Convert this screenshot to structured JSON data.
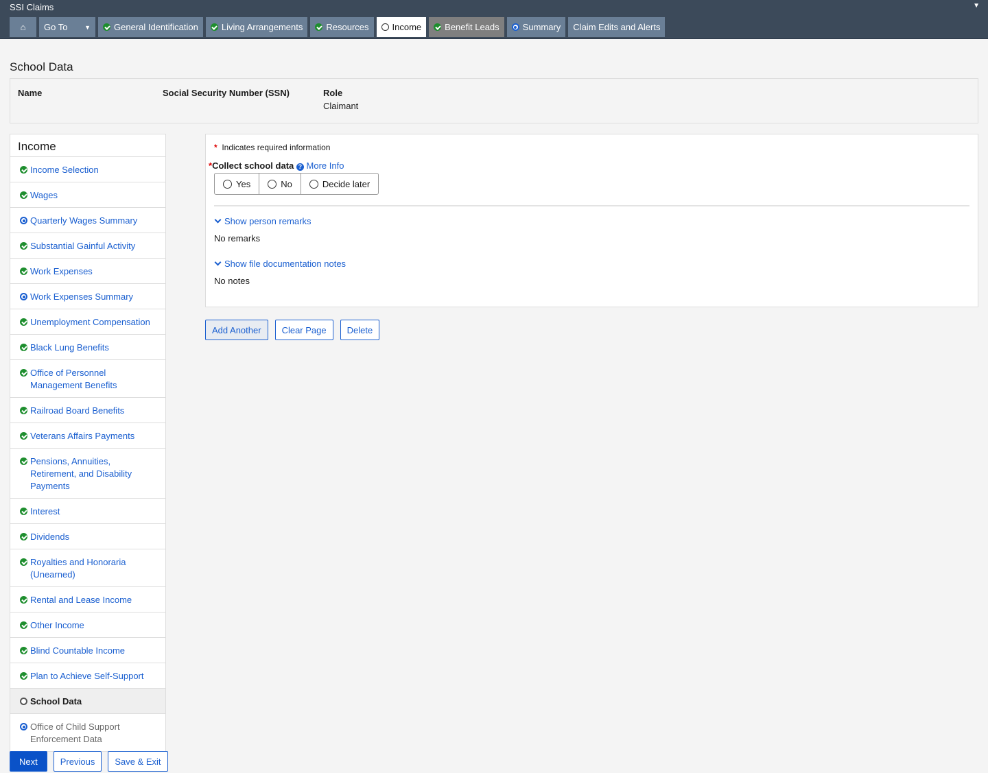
{
  "app": {
    "title": "SSI Claims"
  },
  "nav": {
    "goto": "Go To",
    "tabs": [
      {
        "label": "General Identification",
        "status": "check"
      },
      {
        "label": "Living Arrangements",
        "status": "check"
      },
      {
        "label": "Resources",
        "status": "check"
      },
      {
        "label": "Income",
        "status": "empty"
      },
      {
        "label": "Benefit Leads",
        "status": "check"
      },
      {
        "label": "Summary",
        "status": "target"
      },
      {
        "label": "Claim Edits and Alerts",
        "status": "none"
      }
    ]
  },
  "page": {
    "title": "School Data"
  },
  "person": {
    "name_label": "Name",
    "ssn_label": "Social Security Number (SSN)",
    "role_label": "Role",
    "role_value": "Claimant"
  },
  "sidebar": {
    "title": "Income",
    "items": [
      {
        "label": "Income Selection",
        "status": "check"
      },
      {
        "label": "Wages",
        "status": "check"
      },
      {
        "label": "Quarterly Wages Summary",
        "status": "target"
      },
      {
        "label": "Substantial Gainful Activity",
        "status": "check"
      },
      {
        "label": "Work Expenses",
        "status": "check"
      },
      {
        "label": "Work Expenses Summary",
        "status": "target"
      },
      {
        "label": "Unemployment Compensation",
        "status": "check"
      },
      {
        "label": "Black Lung Benefits",
        "status": "check"
      },
      {
        "label": "Office of Personnel Management Benefits",
        "status": "check"
      },
      {
        "label": "Railroad Board Benefits",
        "status": "check"
      },
      {
        "label": "Veterans Affairs Payments",
        "status": "check"
      },
      {
        "label": "Pensions, Annuities, Retirement, and Disability Payments",
        "status": "check"
      },
      {
        "label": "Interest",
        "status": "check"
      },
      {
        "label": "Dividends",
        "status": "check"
      },
      {
        "label": "Royalties and Honoraria (Unearned)",
        "status": "check"
      },
      {
        "label": "Rental and Lease Income",
        "status": "check"
      },
      {
        "label": "Other Income",
        "status": "check"
      },
      {
        "label": "Blind Countable Income",
        "status": "check"
      },
      {
        "label": "Plan to Achieve Self-Support",
        "status": "check"
      },
      {
        "label": "School Data",
        "status": "empty"
      },
      {
        "label": "Office of Child Support Enforcement Data",
        "status": "target"
      }
    ]
  },
  "form": {
    "required_note": "Indicates required information",
    "required_mark": "*",
    "question": "Collect school data",
    "more_info": "More Info",
    "options": [
      "Yes",
      "No",
      "Decide later"
    ],
    "remarks_toggle": "Show person remarks",
    "remarks_value": "No remarks",
    "notes_toggle": "Show file documentation notes",
    "notes_value": "No notes"
  },
  "actions": {
    "add_another": "Add Another",
    "clear_page": "Clear Page",
    "delete": "Delete"
  },
  "footer": {
    "next": "Next",
    "previous": "Previous",
    "save_exit": "Save & Exit"
  }
}
